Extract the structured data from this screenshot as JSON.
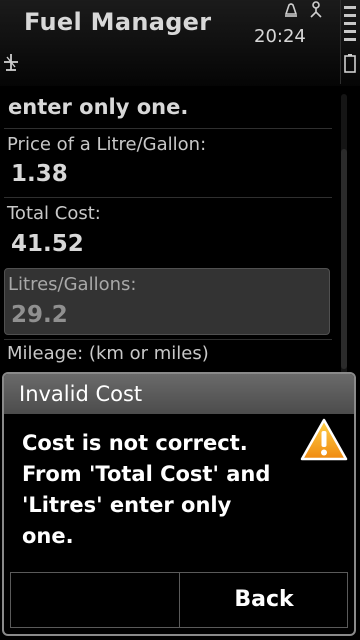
{
  "titlebar": {
    "app_title": "Fuel Manager",
    "clock": "20:24"
  },
  "form": {
    "instruction": "enter only one.",
    "fields": [
      {
        "label": "Price of a Litre/Gallon:",
        "value": "1.38"
      },
      {
        "label": "Total Cost:",
        "value": "41.52"
      },
      {
        "label": "Litres/Gallons:",
        "value": "29.2"
      },
      {
        "label": "Mileage: (km or miles)"
      }
    ]
  },
  "dialog": {
    "title": "Invalid Cost",
    "message": "Cost is not correct. From 'Total Cost' and 'Litres' enter only one.",
    "right_softkey": "Back",
    "icon": "warning-icon"
  },
  "icons": {
    "status_left": "usb-connection-icon",
    "status_a": "alarm-icon",
    "status_b": "profile-icon",
    "battery": "battery-icon"
  },
  "colors": {
    "warning": "#f7a21b",
    "dialog_header": "#5a5a5a"
  }
}
